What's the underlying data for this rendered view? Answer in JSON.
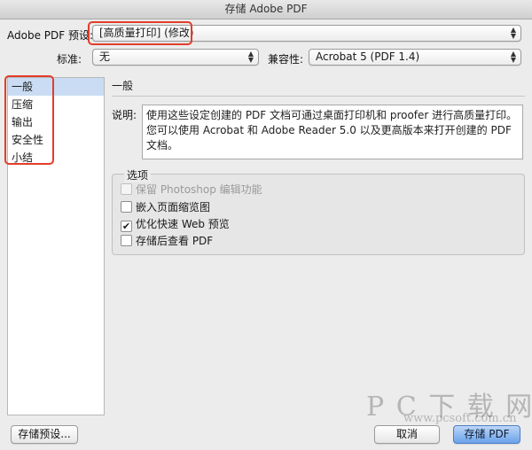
{
  "window": {
    "title": "存储 Adobe PDF"
  },
  "preset": {
    "label": "Adobe PDF 预设:",
    "value": "[高质量打印] (修改)"
  },
  "standard": {
    "label": "标准:",
    "value": "无"
  },
  "compat": {
    "label": "兼容性:",
    "value": "Acrobat 5 (PDF 1.4)"
  },
  "sidebar": {
    "items": [
      {
        "label": "一般"
      },
      {
        "label": "压缩"
      },
      {
        "label": "输出"
      },
      {
        "label": "安全性"
      },
      {
        "label": "小结"
      }
    ]
  },
  "main": {
    "section_title": "一般",
    "description_label": "说明:",
    "description_text": "使用这些设定创建的 PDF 文档可通过桌面打印机和 proofer 进行高质量打印。您可以使用 Acrobat 和 Adobe Reader 5.0 以及更高版本来打开创建的 PDF 文档。",
    "options_title": "选项",
    "options": [
      {
        "label": "保留 Photoshop 编辑功能",
        "checked": false,
        "disabled": true
      },
      {
        "label": "嵌入页面缩览图",
        "checked": false,
        "disabled": false
      },
      {
        "label": "优化快速 Web 预览",
        "checked": true,
        "disabled": false
      },
      {
        "label": "存储后查看 PDF",
        "checked": false,
        "disabled": false
      }
    ]
  },
  "footer": {
    "save_preset_label": "存储预设...",
    "cancel_label": "取消",
    "save_pdf_label": "存储 PDF"
  },
  "watermark": {
    "brand": "P C 下 载 网",
    "url": "www.pcsoft.com.cn"
  },
  "colors": {
    "highlight_box": "#e23d2a",
    "selection": "#c9dcf3",
    "primary_button": "#6ba2ea"
  }
}
